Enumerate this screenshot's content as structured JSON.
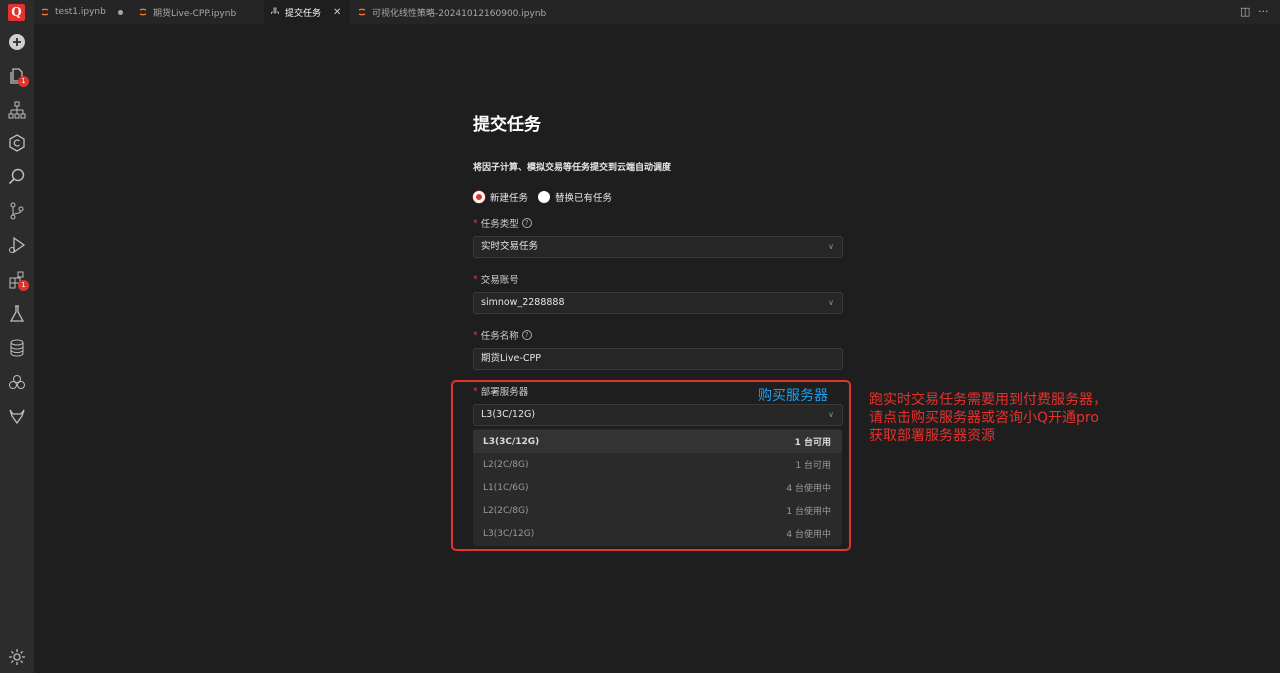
{
  "app": {
    "logo_letter": "Q"
  },
  "activity_bar": {
    "icons": [
      "add-icon",
      "files-icon",
      "sitemap-icon",
      "copyright-icon",
      "search-icon",
      "source-control-icon",
      "run-debug-icon",
      "extensions-icon",
      "flask-icon",
      "database-icon",
      "components-icon",
      "gitlab-icon",
      "settings-icon"
    ],
    "files_badge": "1",
    "extensions_badge": "1"
  },
  "tabs": [
    {
      "label": "test1.ipynb",
      "icon": "jupyter-icon",
      "modified": true,
      "active": false
    },
    {
      "label": "期货Live-CPP.ipynb",
      "icon": "jupyter-icon",
      "active": false
    },
    {
      "label": "提交任务",
      "icon": "sitemap-icon",
      "active": true,
      "close": "✕"
    },
    {
      "label": "可视化线性策略-20241012160900.ipynb",
      "icon": "jupyter-icon",
      "active": false
    }
  ],
  "header_actions": {
    "split": "◫",
    "more": "···"
  },
  "form": {
    "title": "提交任务",
    "description": "将因子计算、模拟交易等任务提交到云端自动调度",
    "radio_new": "新建任务",
    "radio_replace": "替换已有任务",
    "task_type_label": "任务类型",
    "task_type_value": "实时交易任务",
    "account_label": "交易账号",
    "account_value": "simnow_2288888",
    "name_label": "任务名称",
    "name_value": "期货Live-CPP",
    "server_label": "部署服务器",
    "server_value": "L3(3C/12G)",
    "required_mark": "*",
    "help_mark": "?",
    "chevron": "∨",
    "server_options": [
      {
        "name": "L3(3C/12G)",
        "status": "1 台可用",
        "selected": true
      },
      {
        "name": "L2(2C/8G)",
        "status": "1 台可用"
      },
      {
        "name": "L1(1C/6G)",
        "status": "4 台使用中"
      },
      {
        "name": "L2(2C/8G)",
        "status": "1 台使用中"
      },
      {
        "name": "L3(3C/12G)",
        "status": "4 台使用中"
      }
    ],
    "buy_server_link": "购买服务器"
  },
  "annotation": {
    "line1": "跑实时交易任务需要用到付费服务器，",
    "line2": "请点击购买服务器或咨询小Q开通pro",
    "line3": "获取部署服务器资源"
  },
  "colors": {
    "accent": "#e5322d",
    "link": "#1aa0f0",
    "background": "#1e1e1e"
  }
}
